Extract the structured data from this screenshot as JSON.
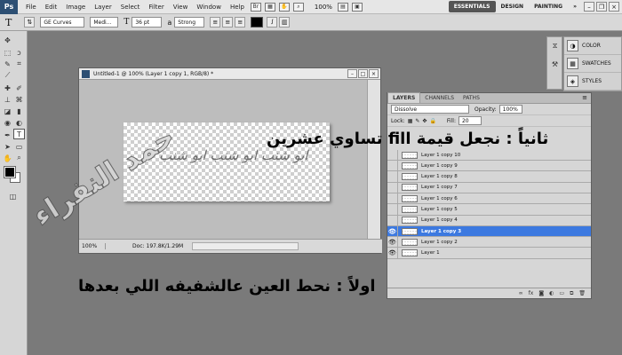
{
  "app": {
    "logo": "Ps"
  },
  "menubar": {
    "items": [
      "File",
      "Edit",
      "Image",
      "Layer",
      "Select",
      "Filter",
      "View",
      "Window",
      "Help"
    ],
    "zoom": "100%",
    "workspaces": [
      "ESSENTIALS",
      "DESIGN",
      "PAINTING",
      "»"
    ],
    "active_workspace": "ESSENTIALS"
  },
  "options": {
    "tool_letter": "T",
    "font_family": "GE Curves",
    "font_style": "Medi...",
    "size_icon": "T",
    "font_size": "36 pt",
    "aa_label": "a",
    "antialias": "Strong",
    "text_color": "#000000"
  },
  "document": {
    "title": "Untitled-1 @ 100% (Layer 1 copy 1, RGB/8) *",
    "canvas_text": "ابو شنب ابو شنب ابو شنب",
    "zoom": "100%",
    "doc_info": "Doc: 197.8K/1.29M"
  },
  "rightdock": {
    "items": [
      {
        "label": "COLOR",
        "icon": "color-icon"
      },
      {
        "label": "SWATCHES",
        "icon": "swatches-icon"
      },
      {
        "label": "STYLES",
        "icon": "styles-icon"
      }
    ]
  },
  "layers_panel": {
    "tabs": [
      "LAYERS",
      "CHANNELS",
      "PATHS"
    ],
    "active_tab": "LAYERS",
    "blend_mode": "Dissolve",
    "opacity_label": "Opacity:",
    "opacity": "100%",
    "lock_label": "Lock:",
    "fill_label": "Fill:",
    "fill": "20",
    "layers": [
      {
        "name": "Layer 1 copy 10",
        "visible": false,
        "selected": false
      },
      {
        "name": "Layer 1 copy 9",
        "visible": false,
        "selected": false
      },
      {
        "name": "Layer 1 copy 8",
        "visible": false,
        "selected": false
      },
      {
        "name": "Layer 1 copy 7",
        "visible": false,
        "selected": false
      },
      {
        "name": "Layer 1 copy 6",
        "visible": false,
        "selected": false
      },
      {
        "name": "Layer 1 copy 5",
        "visible": false,
        "selected": false
      },
      {
        "name": "Layer 1 copy 4",
        "visible": false,
        "selected": false
      },
      {
        "name": "Layer 1 copy 3",
        "visible": true,
        "selected": true
      },
      {
        "name": "Layer 1 copy 2",
        "visible": true,
        "selected": false
      },
      {
        "name": "Layer 1",
        "visible": true,
        "selected": false
      }
    ],
    "footer_icons": [
      "link-icon",
      "fx-icon",
      "mask-icon",
      "adjustment-icon",
      "group-icon",
      "new-layer-icon",
      "trash-icon"
    ]
  },
  "overlays": {
    "top_instruction": "ثانياً : نجعل قيمة fill تساوي عشرين",
    "bottom_instruction": "اولاً : نحط العين عالشفيفه اللي بعدها",
    "watermark": "حمد النفراء"
  },
  "colors": {
    "selected_layer": "#3c79e0",
    "workspace_active_bg": "#555555"
  }
}
